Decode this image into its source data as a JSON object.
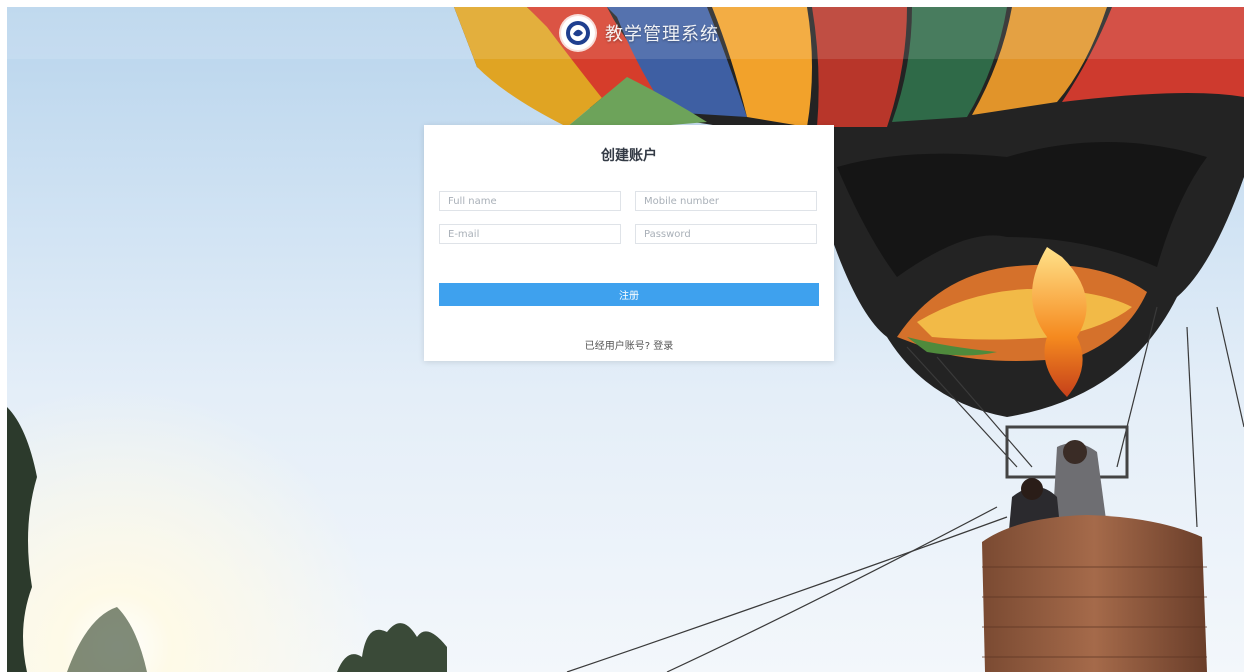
{
  "header": {
    "brand_title": "教学管理系统",
    "logo_icon": "school-logo-icon"
  },
  "form": {
    "title": "创建账户",
    "full_name_placeholder": "Full name",
    "mobile_placeholder": "Mobile number",
    "email_placeholder": "E-mail",
    "password_placeholder": "Password",
    "submit_label": "注册",
    "login_prompt": "已经用户账号?",
    "login_link": "登录"
  },
  "colors": {
    "primary_button": "#3ea1ee",
    "card_background": "#ffffff"
  }
}
